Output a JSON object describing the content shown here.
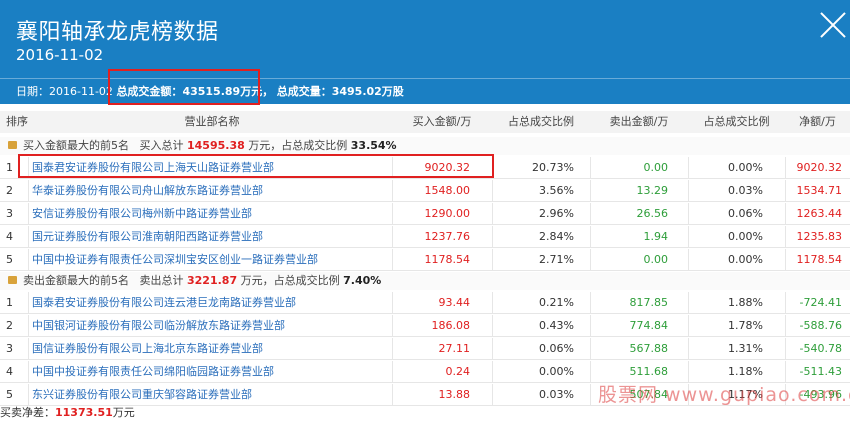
{
  "header": {
    "title": "襄阳轴承龙虎榜数据",
    "date": "2016-11-02",
    "summary_date_label": "日期：",
    "summary_date": "2016-11-02",
    "total_amount_label": "总成交金额：",
    "total_amount": "43515.89万元，",
    "total_volume_label": "总成交量：",
    "total_volume": "3495.02万股"
  },
  "table": {
    "headers": [
      "排序",
      "营业部名称",
      "买入金额/万",
      "占总成交比例",
      "卖出金额/万",
      "占总成交比例",
      "净额/万"
    ]
  },
  "buy_section": {
    "label": "买入金额最大的前5名",
    "total_label": "买入总计",
    "total_value": "14595.38",
    "unit_text": "万元，占总成交比例",
    "ratio": "33.54%"
  },
  "buy_rows": [
    {
      "rank": "1",
      "name": "国泰君安证券股份有限公司上海天山路证券营业部",
      "buy": "9020.32",
      "buy_pct": "20.73%",
      "sell": "0.00",
      "sell_pct": "0.00%",
      "net": "9020.32"
    },
    {
      "rank": "2",
      "name": "华泰证券股份有限公司舟山解放东路证券营业部",
      "buy": "1548.00",
      "buy_pct": "3.56%",
      "sell": "13.29",
      "sell_pct": "0.03%",
      "net": "1534.71"
    },
    {
      "rank": "3",
      "name": "安信证券股份有限公司梅州新中路证券营业部",
      "buy": "1290.00",
      "buy_pct": "2.96%",
      "sell": "26.56",
      "sell_pct": "0.06%",
      "net": "1263.44"
    },
    {
      "rank": "4",
      "name": "国元证券股份有限公司淮南朝阳西路证券营业部",
      "buy": "1237.76",
      "buy_pct": "2.84%",
      "sell": "1.94",
      "sell_pct": "0.00%",
      "net": "1235.83"
    },
    {
      "rank": "5",
      "name": "中国中投证券有限责任公司深圳宝安区创业一路证券营业部",
      "buy": "1178.54",
      "buy_pct": "2.71%",
      "sell": "0.00",
      "sell_pct": "0.00%",
      "net": "1178.54"
    }
  ],
  "sell_section": {
    "label": "卖出金额最大的前5名",
    "total_label": "卖出总计",
    "total_value": "3221.87",
    "unit_text": "万元，占总成交比例",
    "ratio": "7.40%"
  },
  "sell_rows": [
    {
      "rank": "1",
      "name": "国泰君安证券股份有限公司连云港巨龙南路证券营业部",
      "buy": "93.44",
      "buy_pct": "0.21%",
      "sell": "817.85",
      "sell_pct": "1.88%",
      "net": "-724.41"
    },
    {
      "rank": "2",
      "name": "中国银河证券股份有限公司临汾解放东路证券营业部",
      "buy": "186.08",
      "buy_pct": "0.43%",
      "sell": "774.84",
      "sell_pct": "1.78%",
      "net": "-588.76"
    },
    {
      "rank": "3",
      "name": "国信证券股份有限公司上海北京东路证券营业部",
      "buy": "27.11",
      "buy_pct": "0.06%",
      "sell": "567.88",
      "sell_pct": "1.31%",
      "net": "-540.78"
    },
    {
      "rank": "4",
      "name": "中国中投证券有限责任公司绵阳临园路证券营业部",
      "buy": "0.24",
      "buy_pct": "0.00%",
      "sell": "511.68",
      "sell_pct": "1.18%",
      "net": "-511.43"
    },
    {
      "rank": "5",
      "name": "东兴证券股份有限公司重庆邹容路证券营业部",
      "buy": "13.88",
      "buy_pct": "0.03%",
      "sell": "507.84",
      "sell_pct": "1.17%",
      "net": "-493.96"
    }
  ],
  "footer": {
    "net_label": "买卖净差：",
    "net_value": "11373.51",
    "net_unit": "万元"
  },
  "watermark": "股票网 www.gupiao.com.cn",
  "colors": {
    "header_bg": "#1a7fc3",
    "highlight_box": "#e02020",
    "positive": "#e02020",
    "negative": "#2e9e3a",
    "link": "#2a6ebb"
  }
}
